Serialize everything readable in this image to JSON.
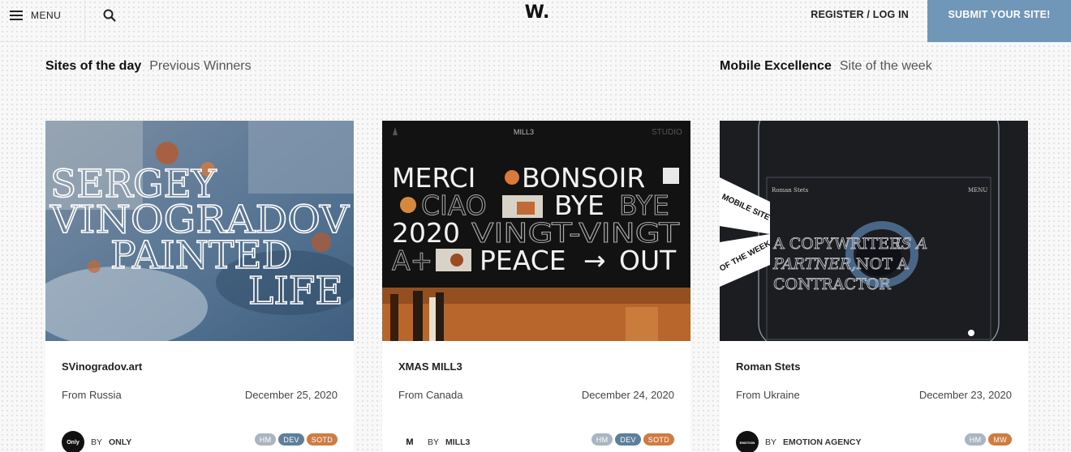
{
  "header": {
    "menu_label": "MENU",
    "logo": "W.",
    "register_label": "REGISTER / LOG IN",
    "submit_label": "SUBMIT YOUR SITE!"
  },
  "sections": {
    "left": {
      "title": "Sites of the day",
      "link": "Previous Winners"
    },
    "right": {
      "title": "Mobile Excellence",
      "link": "Site of the week"
    }
  },
  "colors": {
    "accent": "#7096b8",
    "badge_hm": "#a9b6c2",
    "badge_dev": "#5d7f9c",
    "badge_sotd": "#d07b42",
    "badge_mw": "#d07b42"
  },
  "cards": [
    {
      "name": "SVinogradov.art",
      "from": "From Russia",
      "date": "December 25, 2020",
      "author_prefix": "BY",
      "author": "ONLY",
      "avatar_text": "Only",
      "badges": [
        "HM",
        "DEV",
        "SOTD"
      ],
      "thumb_text": [
        "SERGEY",
        "VINOGRADOV",
        "PAINTED",
        "LIFE"
      ]
    },
    {
      "name": "XMAS MILL3",
      "from": "From Canada",
      "date": "December 24, 2020",
      "author_prefix": "BY",
      "author": "MILL3",
      "avatar_text": "M",
      "badges": [
        "HM",
        "DEV",
        "SOTD"
      ],
      "thumb_text": [
        "MILL3",
        "STUDIO",
        "MERCI",
        "BONSOIR",
        "CIAO",
        "BYE",
        "BYE",
        "2020",
        "VINGT-VINGT",
        "A+",
        "PEACE",
        "→",
        "OUT"
      ]
    },
    {
      "name": "Roman Stets",
      "from": "From Ukraine",
      "date": "December 23, 2020",
      "author_prefix": "BY",
      "author": "EMOTION AGENCY",
      "avatar_text": "EMOTION",
      "badges": [
        "HM",
        "MW"
      ],
      "thumb_text": [
        "Roman Stets",
        "MENU",
        "MOBILE SITE",
        "OF THE WEEK",
        "A COPYWRITER",
        "IS A",
        "PARTNER,",
        "NOT A",
        "CONTRACTOR"
      ]
    }
  ]
}
